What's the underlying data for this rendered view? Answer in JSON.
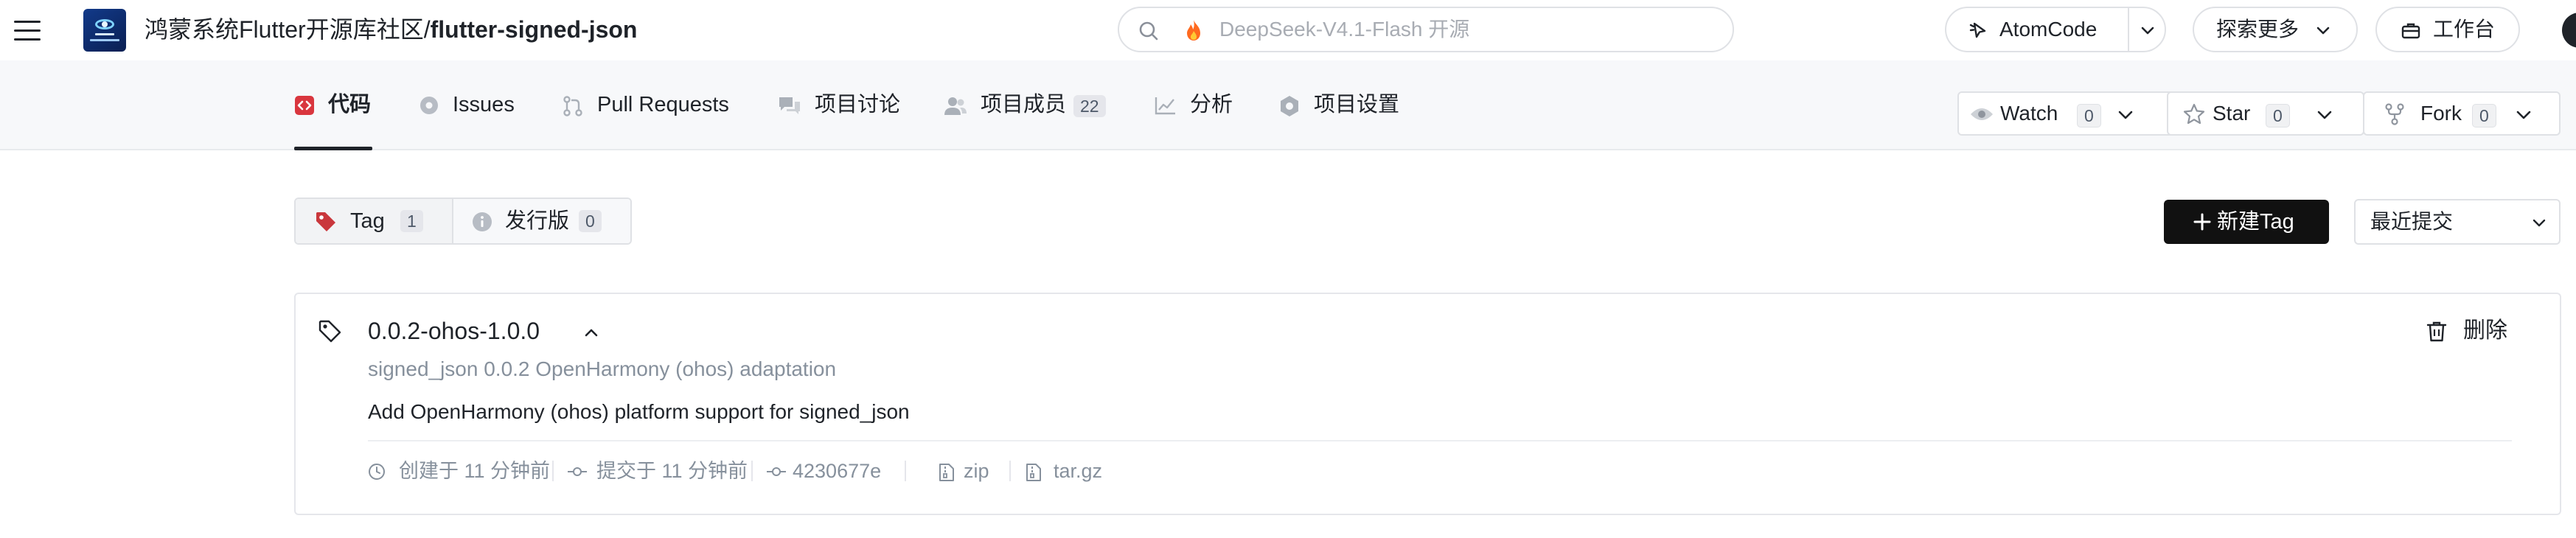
{
  "header": {
    "repo_owner": "鸿蒙系统Flutter开源库社区",
    "separator": "/",
    "repo_name": "flutter-signed-json",
    "search_placeholder": "DeepSeek-V4.1-Flash 开源",
    "atomcode_label": "AtomCode",
    "explore_label": "探索更多",
    "workbench_label": "工作台"
  },
  "tabs": [
    {
      "label": "代码",
      "icon": "code-icon",
      "active": true
    },
    {
      "label": "Issues",
      "icon": "issue-icon"
    },
    {
      "label": "Pull Requests",
      "icon": "pull-request-icon"
    },
    {
      "label": "项目讨论",
      "icon": "discussion-icon"
    },
    {
      "label": "项目成员",
      "icon": "members-icon",
      "count": "22"
    },
    {
      "label": "分析",
      "icon": "chart-icon"
    },
    {
      "label": "项目设置",
      "icon": "gear-icon"
    }
  ],
  "repo_actions": {
    "watch": {
      "label": "Watch",
      "count": "0"
    },
    "star": {
      "label": "Star",
      "count": "0"
    },
    "fork": {
      "label": "Fork",
      "count": "0"
    }
  },
  "toolbar": {
    "tag_label": "Tag",
    "tag_count": "1",
    "release_label": "发行版",
    "release_count": "0",
    "new_tag_label": "新建Tag",
    "sort_label": "最近提交"
  },
  "tag_item": {
    "name": "0.0.2-ohos-1.0.0",
    "title": "signed_json 0.0.2 OpenHarmony (ohos) adaptation",
    "message": "Add OpenHarmony (ohos) platform support for signed_json",
    "delete_label": "删除",
    "created": "创建于 11 分钟前",
    "committed": "提交于 11 分钟前",
    "commit_sha": "4230677e",
    "zip_label": "zip",
    "targz_label": "tar.gz"
  },
  "colors": {
    "accent_dark": "#111111",
    "code_tab_icon": "#d9363e",
    "tag_icon": "#c9373c",
    "muted_text": "#86909c"
  }
}
